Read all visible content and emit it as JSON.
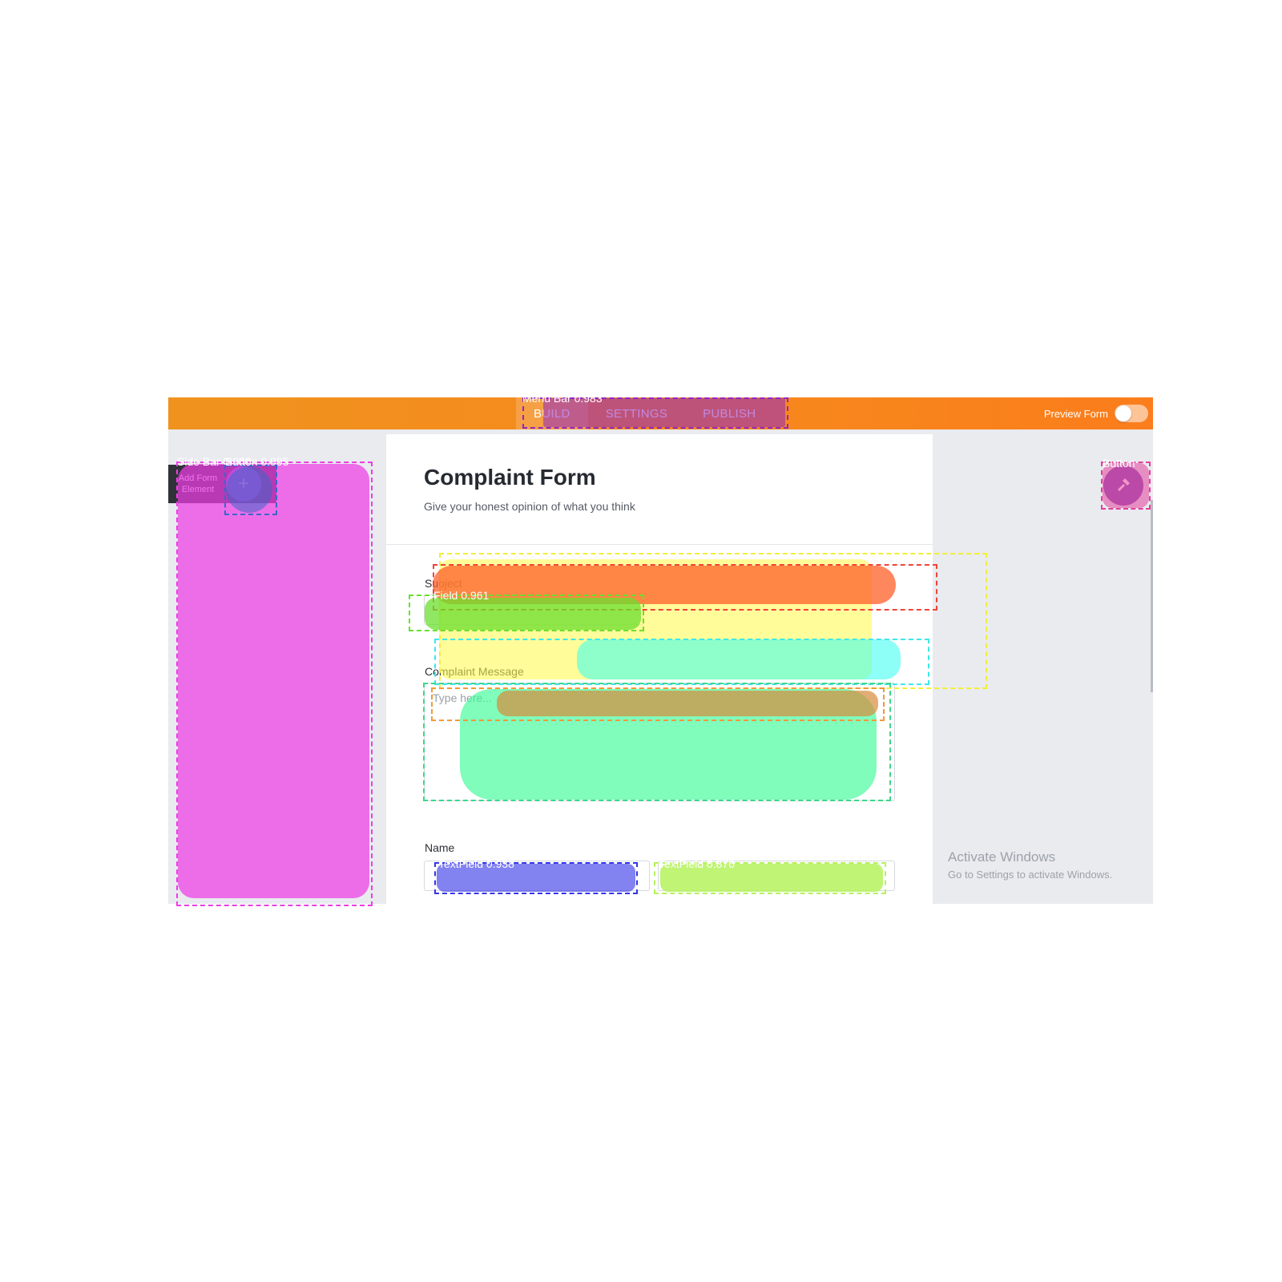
{
  "app": {
    "menu": {
      "items": [
        "BUILD",
        "SETTINGS",
        "PUBLISH"
      ],
      "active": "BUILD"
    },
    "preview": {
      "label": "Preview Form",
      "enabled": false
    }
  },
  "sidebar": {
    "add_label_line1": "Add Form",
    "add_label_line2": "Element",
    "add_icon": "plus-icon"
  },
  "form": {
    "title": "Complaint Form",
    "subtitle": "Give your honest opinion of what you think",
    "subject_label": "Subject",
    "message_label": "Complaint Message",
    "message_placeholder": "Type here...",
    "name_label": "Name"
  },
  "right_panel": {
    "tool_icon": "hammer-icon"
  },
  "watermark": {
    "title": "Activate Windows",
    "subtitle": "Go to Settings to activate Windows."
  },
  "detections": [
    {
      "label": "Menu Bar 0.983",
      "color": "#8f27c7"
    },
    {
      "label": "Side Bar 0.950",
      "color": "#ee3ce6"
    },
    {
      "label": "Button 0.995",
      "color": "#3a67c9"
    },
    {
      "label": "Button",
      "color": "#e43f9c"
    },
    {
      "label": "Field 0.961",
      "color": "#6adf2e"
    },
    {
      "label": "TextField 0.938",
      "color": "#3535e8"
    },
    {
      "label": "TextField 0.876",
      "color": "#b5f25c"
    }
  ],
  "colors": {
    "topbar_start": "#f0931e",
    "topbar_end": "#fb7d1c",
    "card": "#ffffff",
    "background": "#e9ebef"
  }
}
